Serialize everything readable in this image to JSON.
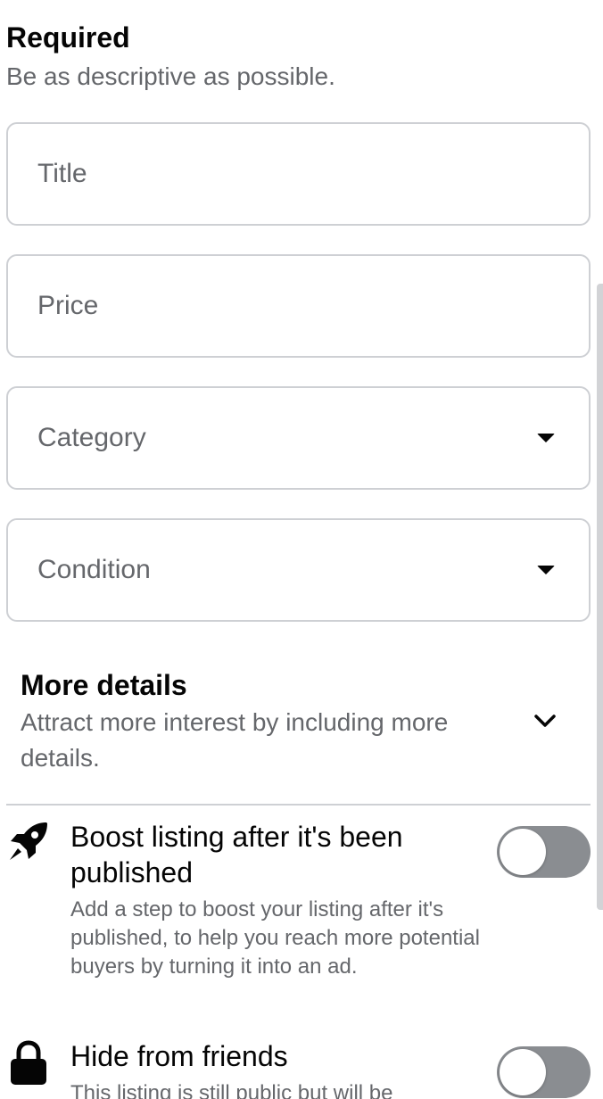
{
  "required": {
    "title": "Required",
    "subtitle": "Be as descriptive as possible."
  },
  "fields": {
    "title_placeholder": "Title",
    "price_placeholder": "Price",
    "category_label": "Category",
    "condition_label": "Condition"
  },
  "more_details": {
    "title": "More details",
    "subtitle": "Attract more interest by including more details."
  },
  "boost": {
    "icon": "rocket-icon",
    "title": "Boost listing after it's been published",
    "description": "Add a step to boost your listing after it's published, to help you reach more potential buyers by turning it into an ad.",
    "enabled": false
  },
  "hide_from_friends": {
    "icon": "lock-icon",
    "title": "Hide from friends",
    "description": "This listing is still public but will be",
    "enabled": false
  },
  "colors": {
    "border": "#ced0d4",
    "secondary_text": "#65676b",
    "toggle_off": "#8a8d91"
  }
}
